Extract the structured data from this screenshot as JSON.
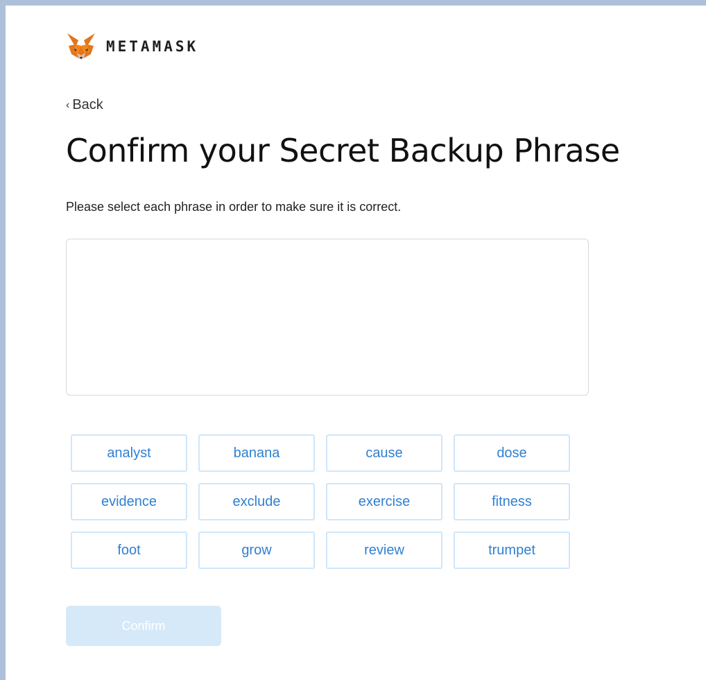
{
  "brand": {
    "name": "METAMASK",
    "logo_icon": "metamask-fox-icon"
  },
  "nav": {
    "back_label": "Back",
    "back_icon": "chevron-left-icon"
  },
  "heading": {
    "title": "Confirm your Secret Backup Phrase",
    "subtitle": "Please select each phrase in order to make sure it is correct."
  },
  "phrase_area": {
    "selected_words": []
  },
  "words": [
    "analyst",
    "banana",
    "cause",
    "dose",
    "evidence",
    "exclude",
    "exercise",
    "fitness",
    "foot",
    "grow",
    "review",
    "trumpet"
  ],
  "actions": {
    "confirm_label": "Confirm",
    "confirm_enabled": false
  },
  "colors": {
    "word_text": "#2f80d1",
    "word_border": "#cfe6fb",
    "confirm_disabled_bg": "#d6e9f8",
    "frame_bg": "#aebfd9"
  }
}
